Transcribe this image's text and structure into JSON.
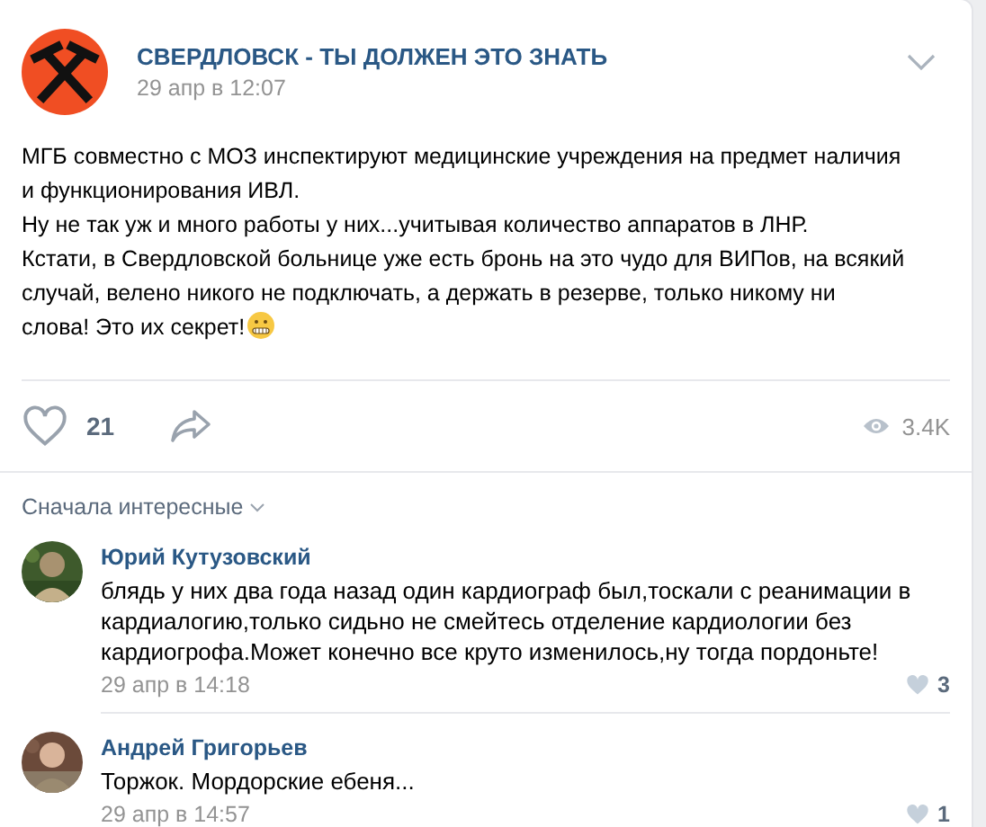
{
  "post": {
    "author": "СВЕРДЛОВСК - ТЫ ДОЛЖЕН ЭТО ЗНАТЬ",
    "time": "29 апр в 12:07",
    "paragraphs": [
      "МГБ совместно с МОЗ инспектируют медицинские учреждения на предмет наличия и функционирования ИВЛ.",
      "Ну не так уж и много работы у них...учитывая количество аппаратов в ЛНР.",
      "Кстати, в Свердловской больнице уже есть бронь на это чудо для ВИПов, на всякий случай, велено никого не подключать, а держать в резерве, только никому ни слова! Это их секрет!"
    ],
    "likes": "21",
    "views": "3.4K"
  },
  "sort": "Сначала интересные",
  "comments": [
    {
      "author": "Юрий Кутузовский",
      "text": "блядь у них два года назад один кардиограф был,тоскали с реанимации в кардиалогию,только сидьно не смейтесь отделение кардиологии без кардиогрофа.Может конечно все круто изменилось,ну тогда пордоньте!",
      "time": "29 апр в 14:18",
      "likes": "3"
    },
    {
      "author": "Андрей Григорьев",
      "text": "Торжок. Мордорские ебеня...",
      "time": "29 апр в 14:57",
      "likes": "1"
    }
  ]
}
